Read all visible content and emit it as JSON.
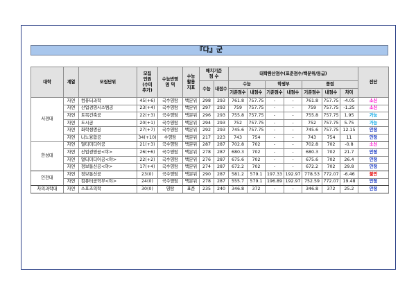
{
  "title": "『다』군",
  "headers": {
    "univ": "대학",
    "track": "계열",
    "dept": "모집단위",
    "quota": [
      "모집",
      "인원",
      "(수미",
      "추가)"
    ],
    "reflect": [
      "수능반영",
      "영    역"
    ],
    "usage": [
      "수능",
      "활용",
      "지표"
    ],
    "cutoff": [
      "배치기준",
      "점    수"
    ],
    "convert": "대학환산점수(표준점수/백분위/등급)",
    "suneung": "수능",
    "school": "학생부",
    "total": "종점",
    "sub_suneung": "수능",
    "sub_internal": "내점수",
    "std": "기준점수",
    "mine": "내점수",
    "diff": "차이",
    "verdict": "진단"
  },
  "groups": [
    {
      "univ": "서경대",
      "rows": [
        {
          "track": "자연",
          "dept": "컴퓨터과학",
          "quota": "45(+6)",
          "area": "국수영탐",
          "usage": "백분위",
          "c1": "298",
          "c2": "293",
          "s1": "761.8",
          "s2": "757.75",
          "h1": "-",
          "h2": "-",
          "t1": "761.8",
          "t2": "757.75",
          "diff": "-4.05",
          "verdict": "소신",
          "color": "pink"
        },
        {
          "track": "자연",
          "dept": "산업경영시스템공",
          "quota": "23(+4)",
          "area": "국수영탐",
          "usage": "백분위",
          "c1": "297",
          "c2": "293",
          "s1": "759",
          "s2": "757.75",
          "h1": "-",
          "h2": "-",
          "t1": "759",
          "t2": "757.75",
          "diff": "-1.25",
          "verdict": "소신",
          "color": "pink"
        },
        {
          "track": "자연",
          "dept": "토목건축공",
          "quota": "22(+3)",
          "area": "국수영탐",
          "usage": "백분위",
          "c1": "296",
          "c2": "293",
          "s1": "755.8",
          "s2": "757.75",
          "h1": "-",
          "h2": "-",
          "t1": "755.8",
          "t2": "757.75",
          "diff": "1.95",
          "verdict": "가능",
          "color": "cyan"
        },
        {
          "track": "자연",
          "dept": "도시공",
          "quota": "20(+1)",
          "area": "국수영탐",
          "usage": "백분위",
          "c1": "294",
          "c2": "293",
          "s1": "752",
          "s2": "757.75",
          "h1": "-",
          "h2": "-",
          "t1": "752",
          "t2": "757.75",
          "diff": "5.75",
          "verdict": "가능",
          "color": "cyan"
        },
        {
          "track": "자연",
          "dept": "화학생명공",
          "quota": "27(+7)",
          "area": "국수영탐",
          "usage": "백분위",
          "c1": "292",
          "c2": "293",
          "s1": "745.6",
          "s2": "757.75",
          "h1": "-",
          "h2": "-",
          "t1": "745.6",
          "t2": "757.75",
          "diff": "12.15",
          "verdict": "안정",
          "color": "blue"
        },
        {
          "track": "자연",
          "dept": "나노융합공",
          "quota": "34(+10)",
          "area": "수영탐",
          "usage": "백분위",
          "c1": "217",
          "c2": "223",
          "s1": "743",
          "s2": "754",
          "h1": "-",
          "h2": "-",
          "t1": "743",
          "t2": "754",
          "diff": "11",
          "verdict": "안정",
          "color": "blue"
        }
      ]
    },
    {
      "univ": "한성대",
      "rows": [
        {
          "track": "자연",
          "dept": "멀티미디어공",
          "quota": "21(+3)",
          "area": "국수영탐",
          "usage": "백분위",
          "c1": "287",
          "c2": "287",
          "s1": "702.8",
          "s2": "702",
          "h1": "-",
          "h2": "-",
          "t1": "702.8",
          "t2": "702",
          "diff": "-0.8",
          "verdict": "소신",
          "color": "pink"
        },
        {
          "track": "자연",
          "dept": "산업경영공<야>",
          "quota": "26(+6)",
          "area": "국수영탐",
          "usage": "백분위",
          "c1": "278",
          "c2": "287",
          "s1": "680.3",
          "s2": "702",
          "h1": "-",
          "h2": "-",
          "t1": "680.3",
          "t2": "702",
          "diff": "21.7",
          "verdict": "안정",
          "color": "blue"
        },
        {
          "track": "자연",
          "dept": "멀티미디어공<야>",
          "quota": "22(+2)",
          "area": "국수영탐",
          "usage": "백분위",
          "c1": "276",
          "c2": "287",
          "s1": "675.6",
          "s2": "702",
          "h1": "-",
          "h2": "-",
          "t1": "675.6",
          "t2": "702",
          "diff": "26.4",
          "verdict": "안정",
          "color": "blue"
        },
        {
          "track": "자연",
          "dept": "정보통신공<야>",
          "quota": "17(+4)",
          "area": "국수영탐",
          "usage": "백분위",
          "c1": "274",
          "c2": "287",
          "s1": "672.2",
          "s2": "702",
          "h1": "-",
          "h2": "-",
          "t1": "672.2",
          "t2": "702",
          "diff": "29.8",
          "verdict": "안정",
          "color": "blue"
        }
      ]
    },
    {
      "univ": "인천대",
      "rows": [
        {
          "track": "자연",
          "dept": "정보통신공",
          "quota": "23(0)",
          "area": "국수영탐",
          "usage": "백분위",
          "c1": "290",
          "c2": "287",
          "s1": "581.2",
          "s2": "579.1",
          "h1": "197.33",
          "h2": "192.97",
          "t1": "778.53",
          "t2": "772.07",
          "diff": "-6.46",
          "verdict": "불안",
          "color": "red"
        },
        {
          "track": "자연",
          "dept": "컴퓨터공학부<야>",
          "quota": "24(0)",
          "area": "국수영탐",
          "usage": "백분위",
          "c1": "278",
          "c2": "287",
          "s1": "555.7",
          "s2": "579.1",
          "h1": "196.89",
          "h2": "192.97",
          "t1": "752.59",
          "t2": "772.07",
          "diff": "19.48",
          "verdict": "안정",
          "color": "blue"
        }
      ]
    },
    {
      "univ": "차의과학대",
      "rows": [
        {
          "track": "자연",
          "dept": "스포츠의학",
          "quota": "30(0)",
          "area": "영탐",
          "usage": "표준",
          "c1": "235",
          "c2": "240",
          "s1": "346.8",
          "s2": "372",
          "h1": "-",
          "h2": "-",
          "t1": "346.8",
          "t2": "372",
          "diff": "25.2",
          "verdict": "안정",
          "color": "blue"
        }
      ]
    }
  ]
}
